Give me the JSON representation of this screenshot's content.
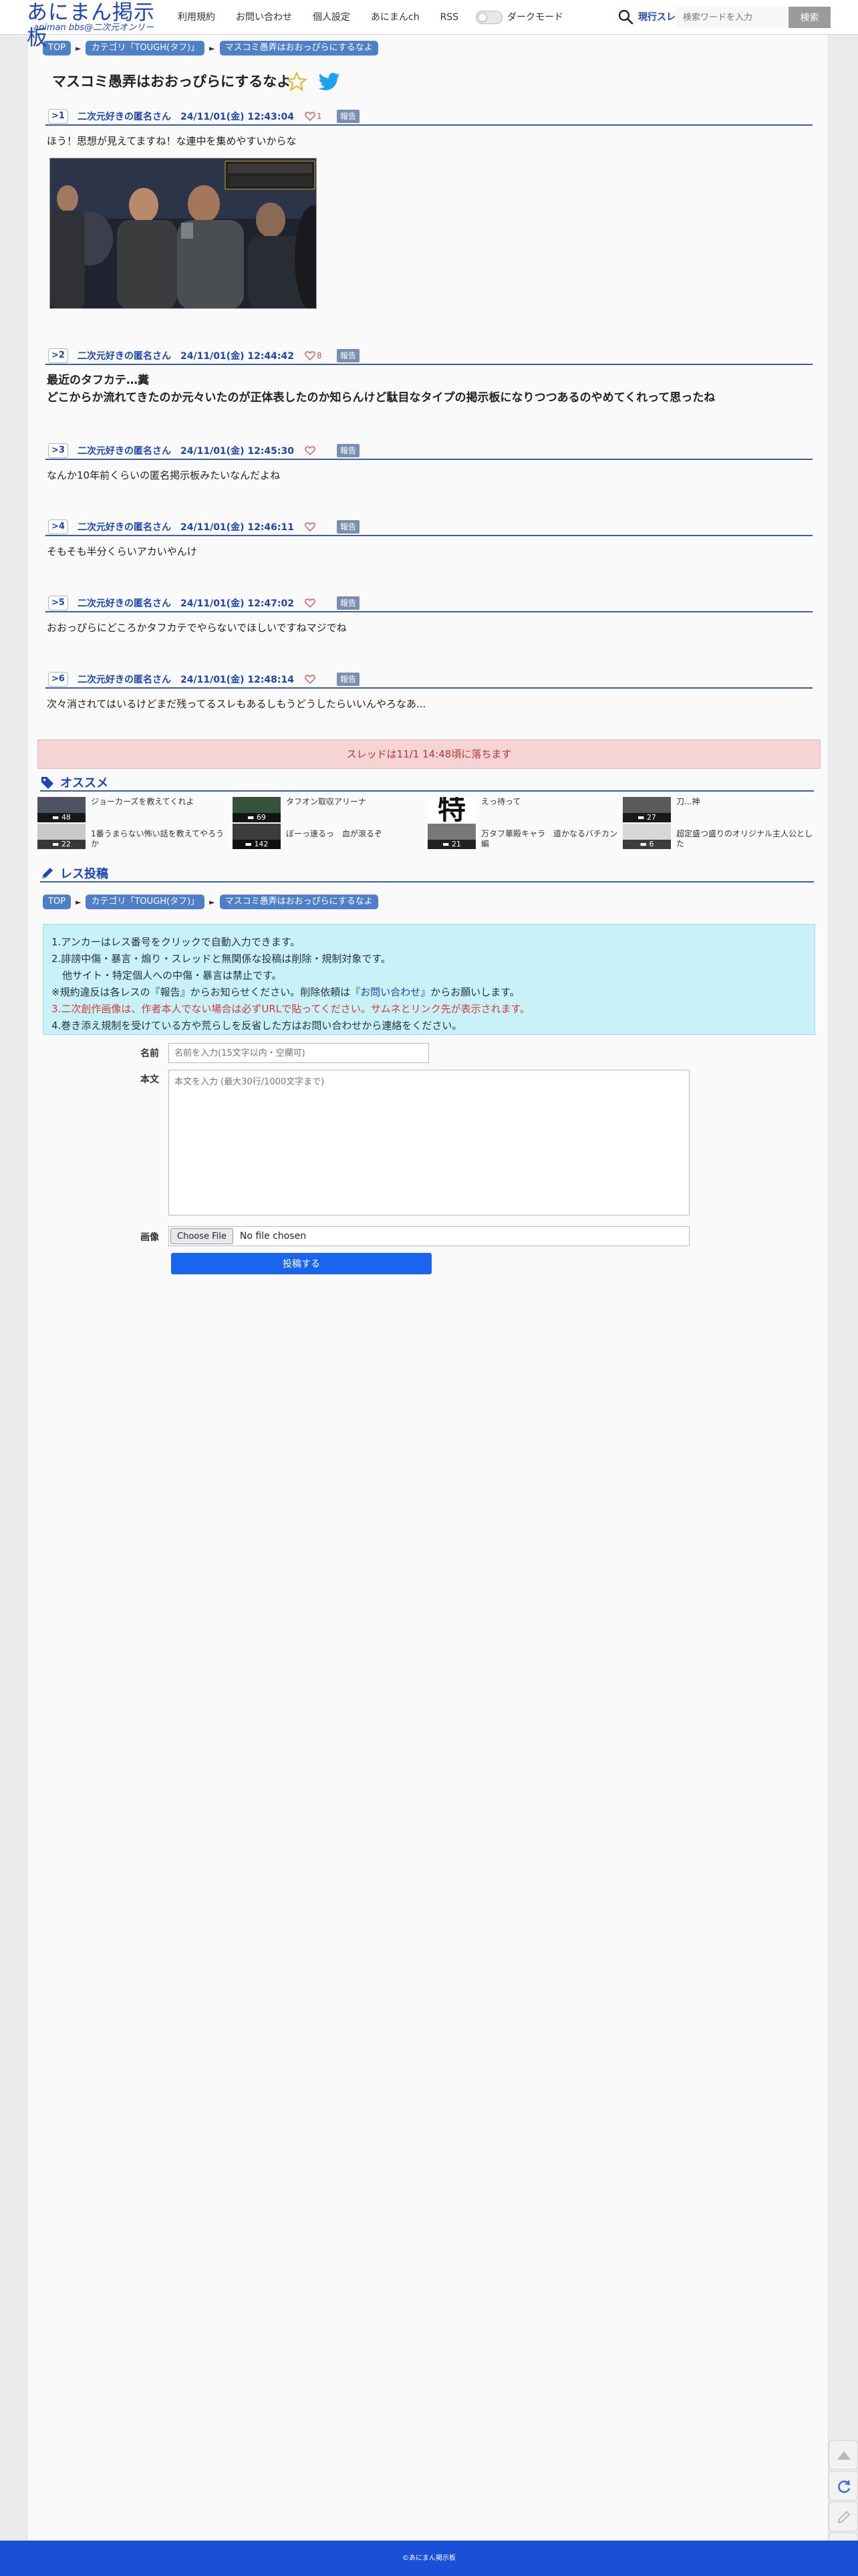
{
  "header": {
    "logo_main": "あにまん掲示板",
    "logo_sub": "animan bbs@二次元オンリー",
    "nav": [
      "利用規約",
      "お問い合わせ",
      "個人設定",
      "あにまんch",
      "RSS"
    ],
    "dark_mode_label": "ダークモード",
    "hot_label": "現行スレ",
    "search_placeholder": "検索ワードを入力",
    "search_button": "検索"
  },
  "breadcrumb_top": [
    "TOP",
    "カテゴリ「TOUGH(タフ)」",
    "マスコミ愚弄はおおっぴらにするなよ"
  ],
  "thread_title": "マスコミ愚弄はおおっぴらにするなよ",
  "posts": [
    {
      "no": ">1",
      "name": "二次元好きの匿名さん",
      "date": "24/11/01(金) 12:43:04",
      "likes": "1",
      "report": "報告",
      "body": [
        "ほう！思想が見えてますね！な連中を集めやすいからな"
      ]
    },
    {
      "no": ">2",
      "name": "二次元好きの匿名さん",
      "date": "24/11/01(金) 12:44:42",
      "likes": "8",
      "report": "報告",
      "body": [
        "最近のタフカテ…糞",
        "どこからか流れてきたのか元々いたのが正体表したのか知らんけど駄目なタイプの掲示板になりつつあるのやめてくれって思ったね"
      ]
    },
    {
      "no": ">3",
      "name": "二次元好きの匿名さん",
      "date": "24/11/01(金) 12:45:30",
      "likes": "",
      "report": "報告",
      "body": [
        "なんか10年前くらいの匿名掲示板みたいなんだよね"
      ]
    },
    {
      "no": ">4",
      "name": "二次元好きの匿名さん",
      "date": "24/11/01(金) 12:46:11",
      "likes": "",
      "report": "報告",
      "body": [
        "そもそも半分くらいアカいやんけ"
      ]
    },
    {
      "no": ">5",
      "name": "二次元好きの匿名さん",
      "date": "24/11/01(金) 12:47:02",
      "likes": "",
      "report": "報告",
      "body": [
        "おおっぴらにどころかタフカテでやらないでほしいですねマジでね"
      ]
    },
    {
      "no": ">6",
      "name": "二次元好きの匿名さん",
      "date": "24/11/01(金) 12:48:14",
      "likes": "",
      "report": "報告",
      "body": [
        "次々消されてはいるけどまだ残ってるスレもあるしもうどうしたらいいんやろなあ..."
      ]
    }
  ],
  "notice": "スレッドは11/1 14:48頃に落ちます",
  "recommend": {
    "heading": "オススメ",
    "items": [
      {
        "title": "ジョーカーズを教えてくれよ",
        "count": "48"
      },
      {
        "title": "タフオン取収アリーナ",
        "count": "69"
      },
      {
        "title": "えっ待って",
        "count": ""
      },
      {
        "title": "刀...神",
        "count": "27"
      },
      {
        "title": "1番うまらない怖い話を教えてやろうか",
        "count": "22"
      },
      {
        "title": "ぼーっ速るっ　血が滾るぞ",
        "count": "142"
      },
      {
        "title": "万タフ華殿キャラ　道かなるバチカン編",
        "count": "21"
      },
      {
        "title": "超定盛つ盛りのオリジナル主人公とした",
        "count": "6"
      }
    ],
    "thumb_glyph": "特"
  },
  "reply": {
    "heading": "レス投稿"
  },
  "breadcrumb_bottom": [
    "TOP",
    "カテゴリ「TOUGH(タフ)」",
    "マスコミ愚弄はおおっぴらにするなよ"
  ],
  "rules": {
    "line1": "1.アンカーはレス番号をクリックで自動入力できます。",
    "line2": "2.誹謗中傷・暴言・煽り・スレッドと無関係な投稿は削除・規制対象です。",
    "line3": "他サイト・特定個人への中傷・暴言は禁止です。",
    "line4_a": "※規約違反は各レスの『報告』からお知らせください。削除依頼は『",
    "line4_link": "お問い合わせ",
    "line4_b": "』からお願いします。",
    "line5_a": "3.",
    "line5_red": "二次創作画像は、作者本人でない場合は必ずURLで貼ってください。サムネとリンク先が表示されます。",
    "line6": "4.巻き添え規制を受けている方や荒らしを反省した方はお問い合わせから連絡をください。"
  },
  "form": {
    "name_label": "名前",
    "name_placeholder": "名前を入力(15文字以内・空欄可)",
    "body_label": "本文",
    "body_placeholder": "本文を入力 (最大30行/1000文字まで)",
    "image_label": "画像",
    "file_button": "Choose File",
    "file_name": "No file chosen",
    "submit": "投稿する"
  },
  "footer": "©あにまん掲示板",
  "colors": {
    "brand": "#1c46b4",
    "crumb": "#4d80c9",
    "notice_bg": "#f7d4d4",
    "rules_bg": "#c8f2f8",
    "submit": "#1a65f0",
    "footer": "#1a50d8"
  }
}
